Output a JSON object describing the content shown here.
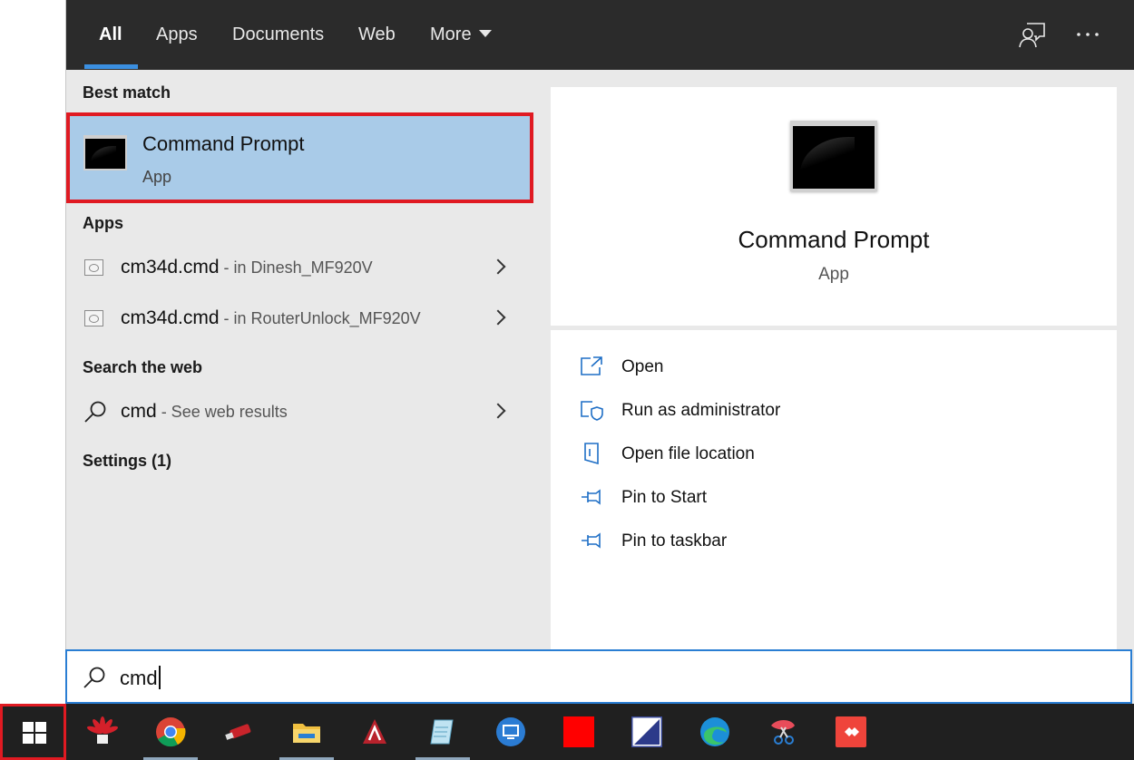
{
  "tabs": [
    {
      "label": "All",
      "active": true
    },
    {
      "label": "Apps"
    },
    {
      "label": "Documents"
    },
    {
      "label": "Web"
    },
    {
      "label": "More"
    }
  ],
  "top_icons": [
    "feedback-icon",
    "more-options-icon"
  ],
  "left": {
    "best_match_heading": "Best match",
    "best_match": {
      "title": "Command Prompt",
      "subtitle": "App",
      "icon": "command-prompt-icon"
    },
    "apps_heading": "Apps",
    "apps": [
      {
        "name": "cm34d.cmd",
        "location": " - in Dinesh_MF920V"
      },
      {
        "name": "cm34d.cmd",
        "location": " - in RouterUnlock_MF920V"
      }
    ],
    "web_heading": "Search the web",
    "web_result": {
      "query": "cmd",
      "hint": " - See web results"
    },
    "settings_heading": "Settings (1)"
  },
  "details": {
    "title": "Command Prompt",
    "subtitle": "App",
    "actions": [
      {
        "label": "Open",
        "icon": "open-icon"
      },
      {
        "label": "Run as administrator",
        "icon": "shield-admin-icon"
      },
      {
        "label": "Open file location",
        "icon": "file-location-icon"
      },
      {
        "label": "Pin to Start",
        "icon": "pin-icon"
      },
      {
        "label": "Pin to taskbar",
        "icon": "pin-icon"
      }
    ]
  },
  "search": {
    "value": "cmd"
  },
  "taskbar": {
    "apps": [
      "huawei-icon",
      "chrome-icon",
      "usb-drive-icon",
      "file-explorer-icon",
      "autocad-icon",
      "notepad-icon",
      "remote-desktop-icon",
      "red-square-app-icon",
      "diagonal-app-icon",
      "edge-icon",
      "snipping-tool-icon",
      "anydesk-icon"
    ]
  },
  "colors": {
    "accent": "#2a7ed3",
    "selection": "#a9cbe8",
    "highlight_box": "#e01a22",
    "taskbar": "#202020",
    "top_bar": "#2b2b2b"
  }
}
